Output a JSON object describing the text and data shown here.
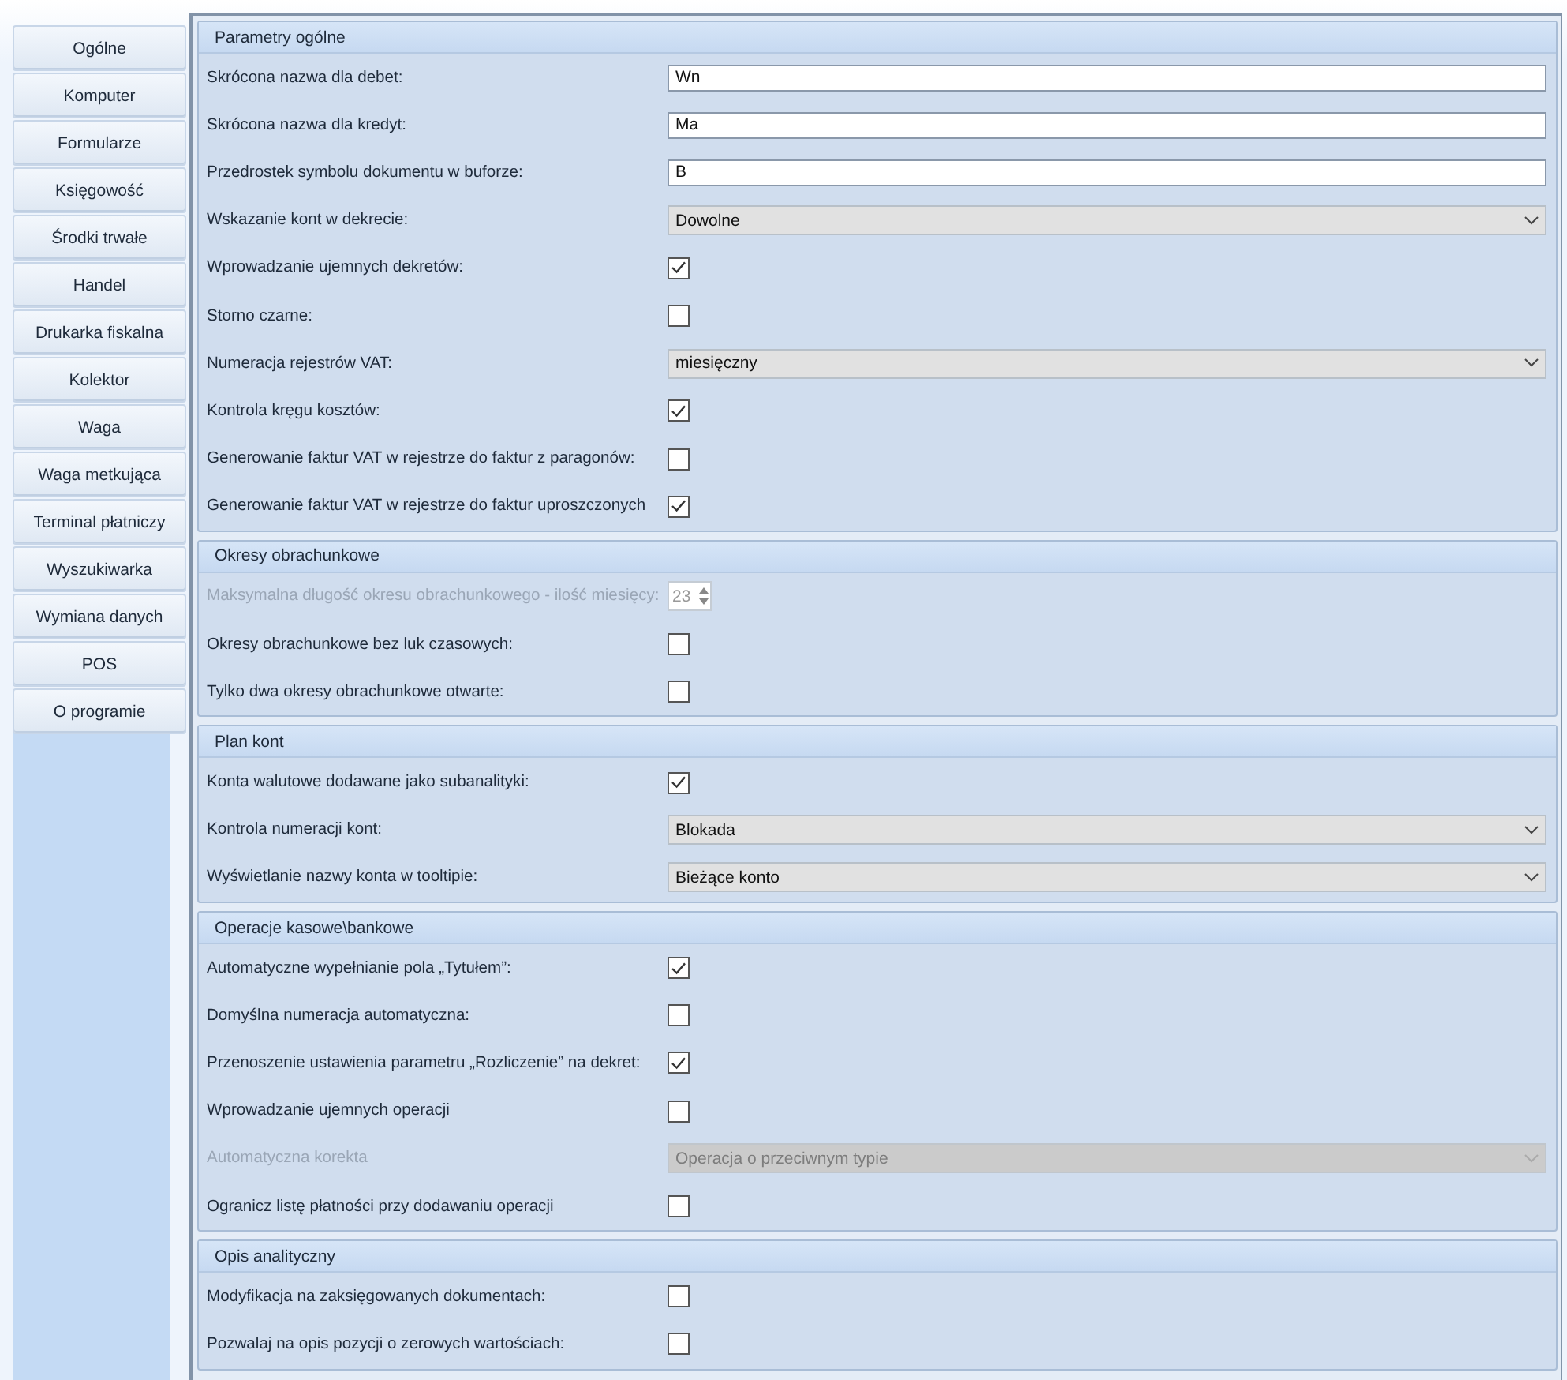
{
  "sidebar": {
    "items": [
      {
        "label": "Ogólne"
      },
      {
        "label": "Komputer"
      },
      {
        "label": "Formularze"
      },
      {
        "label": "Księgowość"
      },
      {
        "label": "Środki trwałe"
      },
      {
        "label": "Handel"
      },
      {
        "label": "Drukarka fiskalna"
      },
      {
        "label": "Kolektor"
      },
      {
        "label": "Waga"
      },
      {
        "label": "Waga metkująca"
      },
      {
        "label": "Terminal płatniczy"
      },
      {
        "label": "Wyszukiwarka"
      },
      {
        "label": "Wymiana danych"
      },
      {
        "label": "POS"
      },
      {
        "label": "O programie"
      }
    ]
  },
  "sections": [
    {
      "title": "Parametry ogólne",
      "rows": [
        {
          "kind": "text",
          "label": "Skrócona nazwa dla debet:",
          "value": "Wn"
        },
        {
          "kind": "text",
          "label": "Skrócona nazwa dla kredyt:",
          "value": "Ma"
        },
        {
          "kind": "text",
          "label": "Przedrostek symbolu dokumentu w buforze:",
          "value": "B"
        },
        {
          "kind": "select",
          "label": "Wskazanie kont w dekrecie:",
          "value": "Dowolne",
          "disabled": false
        },
        {
          "kind": "checkbox",
          "label": "Wprowadzanie ujemnych dekretów:",
          "checked": true,
          "disabled": false
        },
        {
          "kind": "checkbox",
          "label": "Storno czarne:",
          "checked": false,
          "disabled": false
        },
        {
          "kind": "select",
          "label": "Numeracja rejestrów VAT:",
          "value": "miesięczny",
          "disabled": false
        },
        {
          "kind": "checkbox",
          "label": "Kontrola kręgu kosztów:",
          "checked": true,
          "disabled": false
        },
        {
          "kind": "checkbox",
          "label": "Generowanie faktur VAT w rejestrze do faktur z paragonów:",
          "checked": false,
          "disabled": false
        },
        {
          "kind": "checkbox",
          "label": "Generowanie faktur VAT w rejestrze do faktur uproszczonych",
          "checked": true,
          "disabled": false
        }
      ]
    },
    {
      "title": "Okresy obrachunkowe",
      "rows": [
        {
          "kind": "spinner",
          "label": "Maksymalna długość okresu obrachunkowego - ilość miesięcy:",
          "value": "23",
          "disabled": true
        },
        {
          "kind": "checkbox",
          "label": "Okresy obrachunkowe bez luk czasowych:",
          "checked": false,
          "disabled": false
        },
        {
          "kind": "checkbox",
          "label": "Tylko dwa okresy obrachunkowe otwarte:",
          "checked": false,
          "disabled": false
        }
      ]
    },
    {
      "title": "Plan kont",
      "rows": [
        {
          "kind": "checkbox",
          "label": "Konta walutowe dodawane jako subanalityki:",
          "checked": true,
          "disabled": false
        },
        {
          "kind": "select",
          "label": "Kontrola numeracji kont:",
          "value": "Blokada",
          "disabled": false
        },
        {
          "kind": "select",
          "label": "Wyświetlanie nazwy konta w tooltipie:",
          "value": "Bieżące konto",
          "disabled": false
        }
      ]
    },
    {
      "title": "Operacje kasowe\\bankowe",
      "rows": [
        {
          "kind": "checkbox",
          "label": "Automatyczne wypełnianie pola „Tytułem”:",
          "checked": true,
          "disabled": false
        },
        {
          "kind": "checkbox",
          "label": "Domyślna numeracja automatyczna:",
          "checked": false,
          "disabled": false
        },
        {
          "kind": "checkbox",
          "label": "Przenoszenie ustawienia parametru „Rozliczenie” na dekret:",
          "checked": true,
          "disabled": false
        },
        {
          "kind": "checkbox",
          "label": "Wprowadzanie ujemnych operacji",
          "checked": false,
          "disabled": false
        },
        {
          "kind": "select",
          "label": "Automatyczna korekta",
          "value": "Operacja o przeciwnym typie",
          "disabled": true
        },
        {
          "kind": "checkbox",
          "label": "Ogranicz listę płatności przy dodawaniu operacji",
          "checked": false,
          "disabled": false
        }
      ]
    },
    {
      "title": "Opis analityczny",
      "rows": [
        {
          "kind": "checkbox",
          "label": "Modyfikacja na zaksięgowanych dokumentach:",
          "checked": false,
          "disabled": false
        },
        {
          "kind": "checkbox",
          "label": "Pozwalaj na opis pozycji o zerowych wartościach:",
          "checked": false,
          "disabled": false
        }
      ]
    }
  ]
}
